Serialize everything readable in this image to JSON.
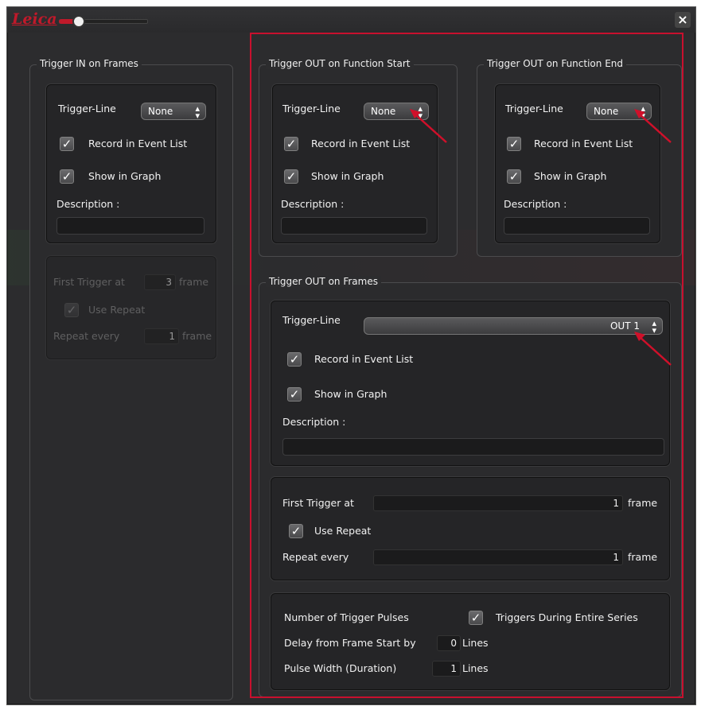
{
  "brand": {
    "logo_text": "Leica",
    "accent_color": "#c8102e"
  },
  "zoom_slider": {
    "value_fraction": 0.22
  },
  "close_label": "×",
  "trigger_in": {
    "title": "Trigger IN on Frames",
    "trigger_line_label": "Trigger-Line",
    "trigger_line_value": "None",
    "record_label": "Record in Event List",
    "record_checked": true,
    "show_graph_label": "Show in Graph",
    "show_graph_checked": true,
    "description_label": "Description :",
    "first_trigger_label": "First Trigger at",
    "first_trigger_value": "3",
    "first_trigger_unit": "frame",
    "use_repeat_label": "Use Repeat",
    "repeat_label": "Repeat every",
    "repeat_value": "1",
    "repeat_unit": "frame"
  },
  "trigger_out_start": {
    "title": "Trigger OUT on Function Start",
    "trigger_line_label": "Trigger-Line",
    "trigger_line_value": "None",
    "record_label": "Record in Event List",
    "show_graph_label": "Show in Graph",
    "description_label": "Description :"
  },
  "trigger_out_end": {
    "title": "Trigger OUT on Function End",
    "trigger_line_label": "Trigger-Line",
    "trigger_line_value": "None",
    "record_label": "Record in Event List",
    "show_graph_label": "Show in Graph",
    "description_label": "Description :"
  },
  "trigger_out_frames": {
    "title": "Trigger OUT on Frames",
    "trigger_line_label": "Trigger-Line",
    "trigger_line_value": "OUT 1",
    "record_label": "Record in Event List",
    "show_graph_label": "Show in Graph",
    "description_label": "Description :",
    "first_trigger_label": "First Trigger at",
    "first_trigger_value": "1",
    "first_trigger_unit": "frame",
    "use_repeat_label": "Use Repeat",
    "repeat_label": "Repeat every",
    "repeat_value": "1",
    "repeat_unit": "frame",
    "pulses_label": "Number of Trigger Pulses",
    "entire_series_label": "Triggers During Entire Series",
    "delay_label": "Delay from Frame Start by",
    "delay_value": "0",
    "delay_unit": "Lines",
    "pulse_width_label": "Pulse Width (Duration)",
    "pulse_width_value": "1",
    "pulse_width_unit": "Lines"
  },
  "check_glyph": "✓",
  "spin_glyph": "▴▾"
}
